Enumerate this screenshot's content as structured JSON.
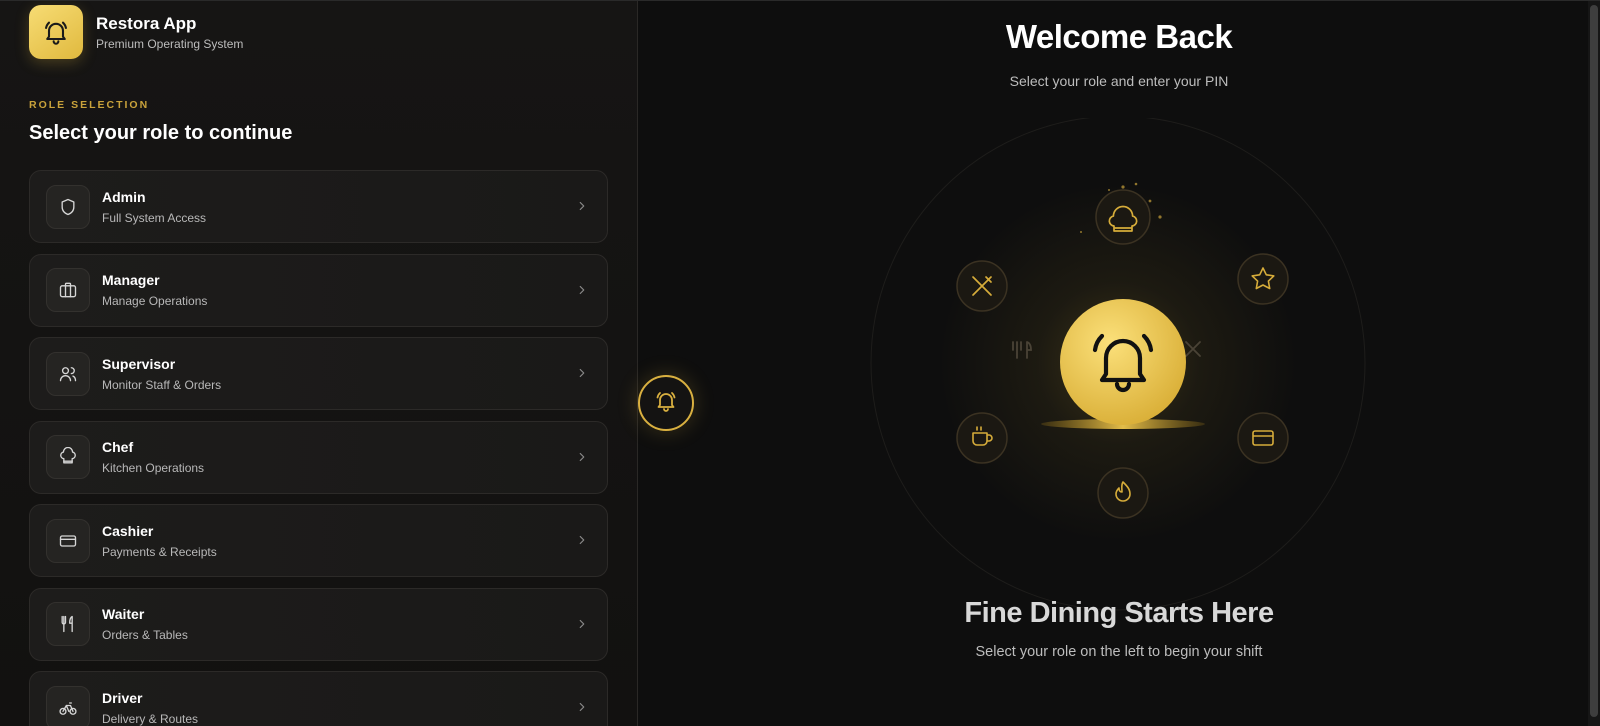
{
  "brand": {
    "title": "Restora App",
    "subtitle": "Premium Operating System",
    "icon": "bell-icon"
  },
  "role_selection": {
    "eyebrow": "ROLE SELECTION",
    "heading": "Select your role to continue",
    "roles": [
      {
        "name": "Admin",
        "desc": "Full System Access",
        "icon": "shield-icon"
      },
      {
        "name": "Manager",
        "desc": "Manage Operations",
        "icon": "briefcase-icon"
      },
      {
        "name": "Supervisor",
        "desc": "Monitor Staff & Orders",
        "icon": "users-icon"
      },
      {
        "name": "Chef",
        "desc": "Kitchen Operations",
        "icon": "chef-hat-icon"
      },
      {
        "name": "Cashier",
        "desc": "Payments & Receipts",
        "icon": "credit-card-icon"
      },
      {
        "name": "Waiter",
        "desc": "Orders & Tables",
        "icon": "utensils-icon"
      },
      {
        "name": "Driver",
        "desc": "Delivery & Routes",
        "icon": "bicycle-icon"
      }
    ]
  },
  "main": {
    "title": "Welcome Back",
    "subtitle": "Select your role and enter your PIN",
    "tagline": "Fine Dining Starts Here",
    "tagline_sub": "Select your role on the left to begin your shift"
  },
  "colors": {
    "accent": "#e0b93e",
    "accent_light": "#f7dc74",
    "background": "#0e0e0e",
    "panel": "#161514"
  }
}
